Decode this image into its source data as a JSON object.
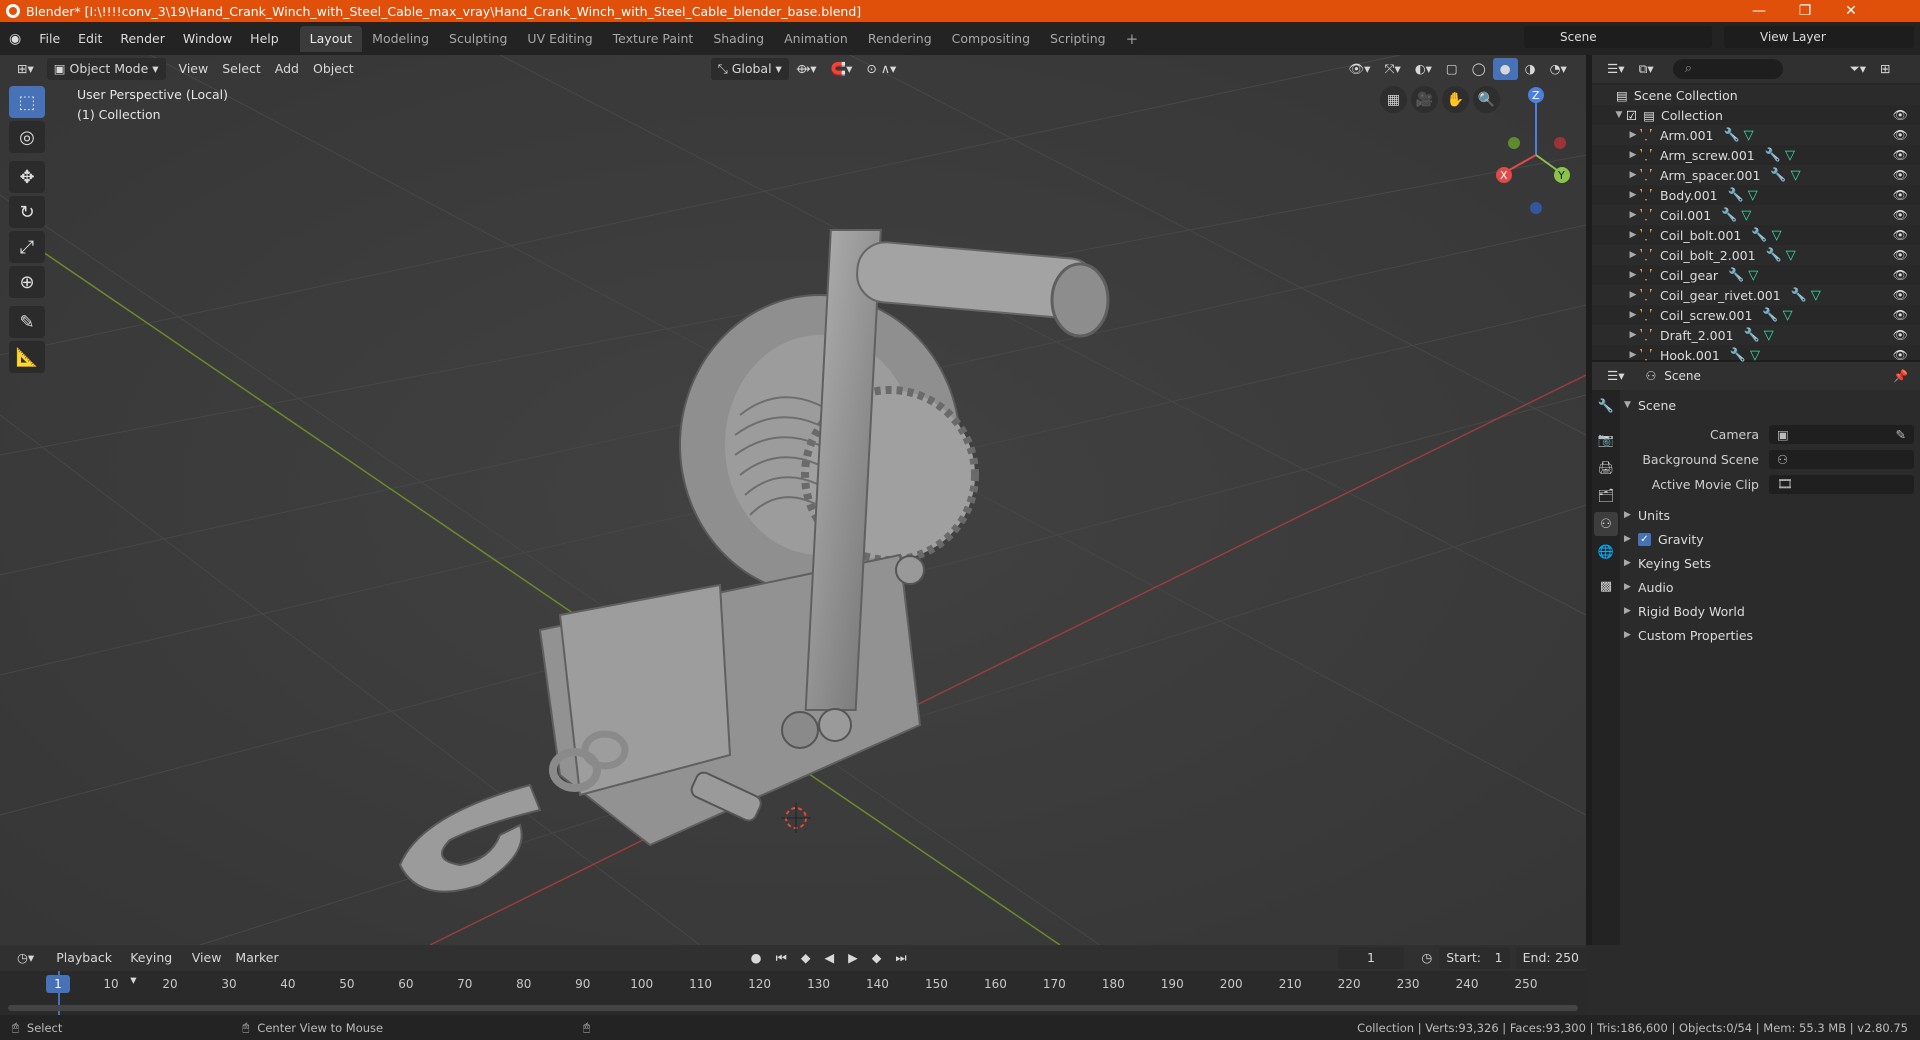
{
  "window": {
    "title": "Blender* [I:\\!!!!conv_3\\19\\Hand_Crank_Winch_with_Steel_Cable_max_vray\\Hand_Crank_Winch_with_Steel_Cable_blender_base.blend]"
  },
  "menu": {
    "file": "File",
    "edit": "Edit",
    "render": "Render",
    "window": "Window",
    "help": "Help"
  },
  "workspaces": [
    "Layout",
    "Modeling",
    "Sculpting",
    "UV Editing",
    "Texture Paint",
    "Shading",
    "Animation",
    "Rendering",
    "Compositing",
    "Scripting"
  ],
  "scene_selector": "Scene",
  "view_layer_selector": "View Layer",
  "viewport_header": {
    "mode": "Object Mode",
    "view": "View",
    "select": "Select",
    "add": "Add",
    "object": "Object",
    "transform": "Global"
  },
  "viewport_info": {
    "perspective": "User Perspective (Local)",
    "collection": "(1) Collection"
  },
  "outliner": {
    "root": "Scene Collection",
    "collection": "Collection",
    "items": [
      "Arm.001",
      "Arm_screw.001",
      "Arm_spacer.001",
      "Body.001",
      "Coil.001",
      "Coil_bolt.001",
      "Coil_bolt_2.001",
      "Coil_gear",
      "Coil_gear_rivet.001",
      "Coil_screw.001",
      "Draft_2.001",
      "Hook.001"
    ]
  },
  "properties": {
    "header": "Scene",
    "section": "Scene",
    "camera_label": "Camera",
    "background_scene_label": "Background Scene",
    "active_movie_clip_label": "Active Movie Clip",
    "subsections": [
      "Units",
      "Gravity",
      "Keying Sets",
      "Audio",
      "Rigid Body World",
      "Custom Properties"
    ]
  },
  "timeline": {
    "playback": "Playback",
    "keying": "Keying",
    "view": "View",
    "marker": "Marker",
    "current_frame": "1",
    "start_label": "Start:",
    "start": "1",
    "end_label": "End:",
    "end": "250",
    "ticks": [
      "1",
      "10",
      "20",
      "30",
      "40",
      "50",
      "60",
      "70",
      "80",
      "90",
      "100",
      "110",
      "120",
      "130",
      "140",
      "150",
      "160",
      "170",
      "180",
      "190",
      "200",
      "210",
      "220",
      "230",
      "240",
      "250"
    ]
  },
  "statusbar": {
    "select": "Select",
    "center_view": "Center View to Mouse",
    "stats": "Collection | Verts:93,326 | Faces:93,300 | Tris:186,600 | Objects:0/54 | Mem: 55.3 MB | v2.80.75"
  },
  "gizmo": {
    "x": "X",
    "y": "Y",
    "z": "Z"
  },
  "colors": {
    "title_bar": "#e0500a",
    "accent": "#4872b8",
    "object_icon": "#e39a4b",
    "modifier": "#5e9de0",
    "mesh": "#3de0a8"
  }
}
